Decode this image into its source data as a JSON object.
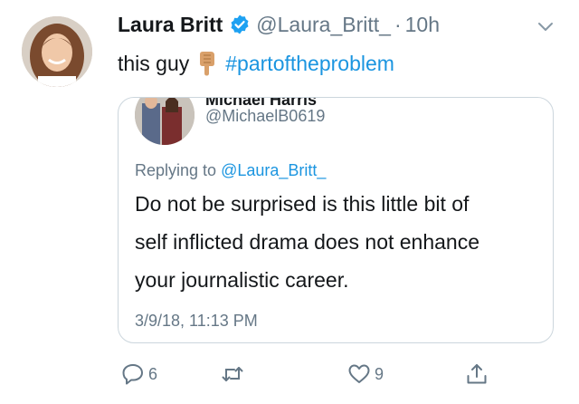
{
  "tweet": {
    "author_name": "Laura Britt",
    "handle": "@Laura_Britt_",
    "separator": "·",
    "time": "10h",
    "text": "this guy",
    "emoji": "backhand-index-pointing-down",
    "hashtag": "#partoftheproblem"
  },
  "quoted_tweet": {
    "author_name": "Michael Harris",
    "handle": "@MichaelB0619",
    "replying_to_label": "Replying to",
    "replying_to_handle": "@Laura_Britt_",
    "body_lines": [
      "Do not be surprised is this little bit of",
      "self inflicted drama does not enhance",
      "your journalistic career."
    ],
    "timestamp": "3/9/18, 11:13 PM"
  },
  "actions": {
    "reply_count": "6",
    "retweet_count": "",
    "like_count": "9"
  },
  "colors": {
    "link": "#1b95e0",
    "secondary_text": "#657786",
    "border": "#ccd6dd",
    "verified": "#1da1f2"
  },
  "icons": [
    "verified-badge-icon",
    "chevron-down-icon",
    "reply-icon",
    "retweet-icon",
    "like-icon",
    "share-icon"
  ]
}
